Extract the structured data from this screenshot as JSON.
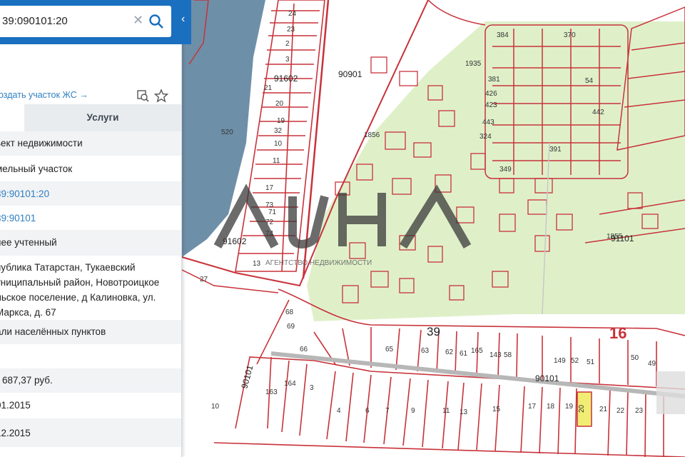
{
  "search": {
    "value": "39:090101:20"
  },
  "actions": {
    "create_link": "оздать участок ЖС →"
  },
  "tabs": {
    "services": "Услуги"
  },
  "rows": [
    "ьект недвижимости",
    "мельный участок",
    "39:90101:20",
    "39:90101",
    "нее учтенный",
    "публика Татарстан, Тукаевский униципальный район, Новотроицкое льское поселение, д Калиновка, ул. Маркса, д. 67",
    "али населённых пунктов",
    "",
    "687,37 руб.",
    "01.2015",
    "12.2015"
  ],
  "map": {
    "watermark": "АГЕНТСТВО НЕДВИЖИМОСТИ",
    "block_labels": [
      "91602",
      "90901",
      "91602",
      "91101",
      "90101",
      "90101"
    ],
    "big_labels": [
      "39",
      "16"
    ],
    "highlighted_parcel": "20",
    "colors": {
      "water": "#6e8fa8",
      "green": "#dff0c9",
      "parcel_line": "#c8323a",
      "highlight": "#f1ec74",
      "panel_accent": "#1a6fbf"
    }
  }
}
